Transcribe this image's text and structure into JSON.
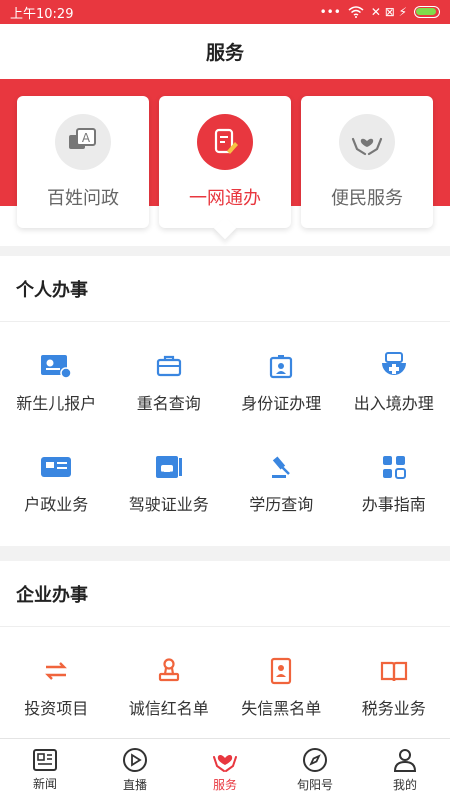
{
  "status_bar": {
    "time": "上午10:29",
    "dots": "•••",
    "network_icons": "✕ ⊠ ⚡"
  },
  "title": "服务",
  "top_cards": [
    {
      "label": "百姓问政",
      "icon": "chat-icon",
      "active": false
    },
    {
      "label": "一网通办",
      "icon": "document-pen-icon",
      "active": true
    },
    {
      "label": "便民服务",
      "icon": "heart-hands-icon",
      "active": false
    }
  ],
  "personal": {
    "title": "个人办事",
    "items": [
      {
        "label": "新生儿报户",
        "icon": "id-card-icon"
      },
      {
        "label": "重名查询",
        "icon": "briefcase-icon"
      },
      {
        "label": "身份证办理",
        "icon": "badge-icon"
      },
      {
        "label": "出入境办理",
        "icon": "passport-icon"
      },
      {
        "label": "户政业务",
        "icon": "household-card-icon"
      },
      {
        "label": "驾驶证业务",
        "icon": "driver-license-icon"
      },
      {
        "label": "学历查询",
        "icon": "gavel-icon"
      },
      {
        "label": "办事指南",
        "icon": "grid-icon"
      }
    ]
  },
  "enterprise": {
    "title": "企业办事",
    "items": [
      {
        "label": "投资项目",
        "icon": "exchange-icon"
      },
      {
        "label": "诚信红名单",
        "icon": "stamp-icon"
      },
      {
        "label": "失信黑名单",
        "icon": "blacklist-icon"
      },
      {
        "label": "税务业务",
        "icon": "book-icon"
      }
    ]
  },
  "bottom_nav": [
    {
      "label": "新闻",
      "icon": "news-icon",
      "active": false
    },
    {
      "label": "直播",
      "icon": "play-icon",
      "active": false
    },
    {
      "label": "服务",
      "icon": "service-heart-icon",
      "active": true
    },
    {
      "label": "旬阳号",
      "icon": "compass-icon",
      "active": false
    },
    {
      "label": "我的",
      "icon": "user-icon",
      "active": false
    }
  ],
  "colors": {
    "accent": "#e8373f",
    "blue_icon": "#3a86e0",
    "orange_icon": "#f0643c"
  }
}
